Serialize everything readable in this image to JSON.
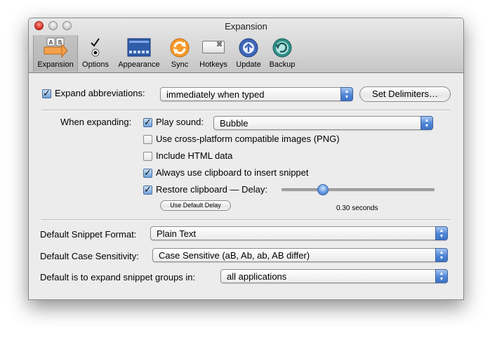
{
  "window": {
    "title": "Expansion"
  },
  "toolbar": {
    "items": [
      {
        "label": "Expansion",
        "icon": "expansion-icon",
        "selected": true
      },
      {
        "label": "Options",
        "icon": "options-icon"
      },
      {
        "label": "Appearance",
        "icon": "appearance-icon"
      },
      {
        "label": "Sync",
        "icon": "sync-icon"
      },
      {
        "label": "Hotkeys",
        "icon": "hotkeys-icon"
      },
      {
        "label": "Update",
        "icon": "update-icon"
      },
      {
        "label": "Backup",
        "icon": "backup-icon"
      }
    ],
    "expansion_key_a": "A",
    "expansion_key_b": "B",
    "hotkey_glyph": "⌘"
  },
  "expand": {
    "checkbox_label": "Expand abbreviations:",
    "checked": true,
    "mode": "immediately when typed",
    "delimiters_button": "Set Delimiters…"
  },
  "when_expanding": {
    "label": "When expanding:",
    "play_sound": {
      "label": "Play sound:",
      "checked": true,
      "sound": "Bubble"
    },
    "png": {
      "label": "Use cross-platform compatible images (PNG)",
      "checked": false
    },
    "html": {
      "label": "Include HTML data",
      "checked": false
    },
    "clipboard": {
      "label": "Always use clipboard to insert snippet",
      "checked": true
    },
    "restore": {
      "label": "Restore clipboard — Delay:",
      "checked": true
    },
    "delay_slider_fraction": 0.25,
    "default_delay_button": "Use Default Delay",
    "delay_value": "0.30 seconds"
  },
  "defaults": {
    "format_label": "Default Snippet Format:",
    "format_value": "Plain Text",
    "case_label": "Default Case Sensitivity:",
    "case_value": "Case Sensitive (aB, Ab, ab, AB differ)",
    "groups_label": "Default is to expand snippet groups in:",
    "groups_value": "all applications"
  },
  "colors": {
    "accent": "#4f85d6",
    "close_button": "#d4271b"
  }
}
